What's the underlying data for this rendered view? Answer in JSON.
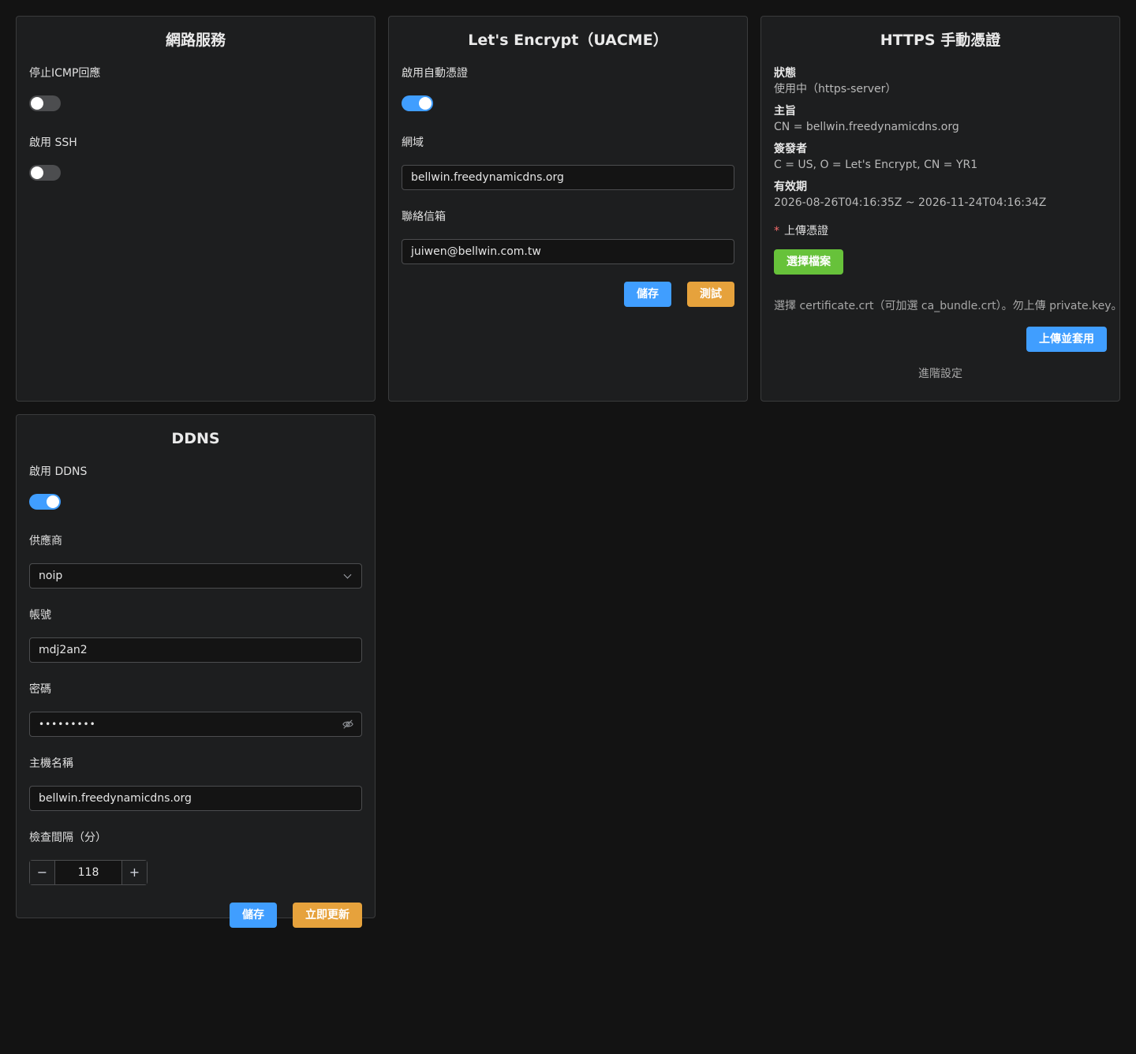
{
  "network": {
    "title": "網路服務",
    "icmp_label": "停止ICMP回應",
    "ssh_label": "啟用 SSH"
  },
  "letsencrypt": {
    "title": "Let's Encrypt（UACME）",
    "auto_label": "啟用自動憑證",
    "domain_label": "網域",
    "domain_value": "bellwin.freedynamicdns.org",
    "email_label": "聯絡信箱",
    "email_value": "juiwen@bellwin.com.tw",
    "save": "儲存",
    "test": "測試"
  },
  "https": {
    "title": "HTTPS 手動憑證",
    "status_label": "狀態",
    "status_value": "使用中（https-server）",
    "subject_label": "主旨",
    "subject_value": "CN = bellwin.freedynamicdns.org",
    "issuer_label": "簽發者",
    "issuer_value": "C = US, O = Let's Encrypt, CN = YR1",
    "validity_label": "有效期",
    "validity_value": "2026-08-26T04:16:35Z ~ 2026-11-24T04:16:34Z",
    "required_mark": "*",
    "upload_label": "上傳憑證",
    "choose_file": "選擇檔案",
    "hint": "選擇 certificate.crt（可加選 ca_bundle.crt）。勿上傳 private.key。",
    "upload_apply": "上傳並套用",
    "advanced": "進階設定"
  },
  "ddns": {
    "title": "DDNS",
    "enable_label": "啟用 DDNS",
    "provider_label": "供應商",
    "provider_value": "noip",
    "account_label": "帳號",
    "account_value": "mdj2an2",
    "password_label": "密碼",
    "password_value": "•••••••••",
    "hostname_label": "主機名稱",
    "hostname_value": "bellwin.freedynamicdns.org",
    "interval_label": "檢查間隔（分）",
    "interval_value": "118",
    "minus": "−",
    "plus": "+",
    "save": "儲存",
    "update_now": "立即更新"
  },
  "colors": {
    "primary": "#409eff",
    "warning": "#e6a23c",
    "success": "#67c23a",
    "background": "#131313",
    "card": "#1d1e1f"
  },
  "states": {
    "icmp_off": true,
    "ssh_off": true,
    "auto_cert_on": true,
    "ddns_on": true
  }
}
